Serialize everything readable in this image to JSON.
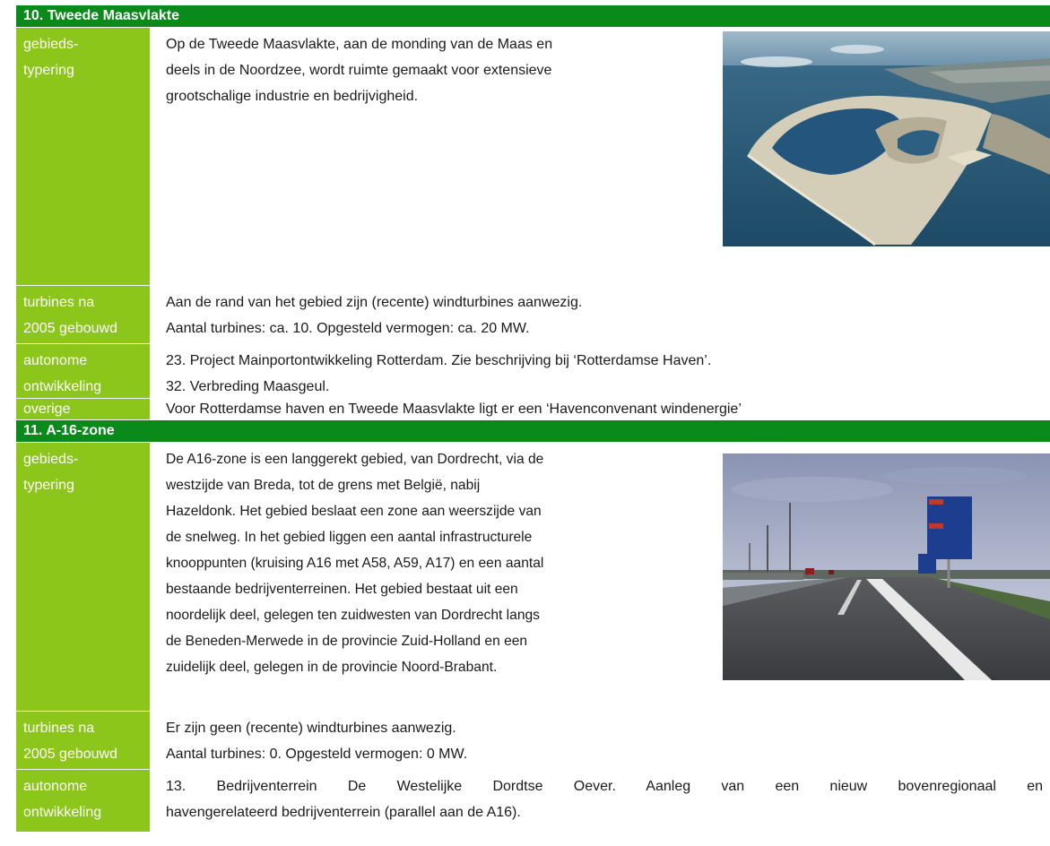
{
  "sections": [
    {
      "title": "10. Tweede Maasvlakte",
      "typering_label": [
        "gebieds-",
        "typering"
      ],
      "typering_text": [
        "Op de Tweede Maasvlakte, aan de monding van de Maas en",
        "deels in de Noordzee, wordt ruimte gemaakt voor extensieve",
        "grootschalige industrie en bedrijvigheid."
      ],
      "photo_icon": "aerial-harbor-photo",
      "turbines_label": [
        "turbines na",
        "2005 gebouwd"
      ],
      "turbines_text": [
        "Aan de rand van het gebied zijn (recente) windturbines aanwezig.",
        "Aantal turbines: ca. 10. Opgesteld vermogen: ca. 20 MW."
      ],
      "autonoom_label": [
        "autonome",
        "ontwikkeling"
      ],
      "autonoom_text": [
        "23. Project Mainportontwikkeling Rotterdam. Zie beschrijving bij ‘Rotterdamse Haven’.",
        "32. Verbreding Maasgeul."
      ],
      "overige_label": "overige",
      "overige_text": "Voor Rotterdamse haven en Tweede Maasvlakte ligt er een ‘Havenconvenant windenergie’"
    },
    {
      "title": "11. A-16-zone",
      "typering_label": [
        "gebieds-",
        "typering"
      ],
      "typering_text": [
        "De A16-zone is een langgerekt gebied, van Dordrecht, via de",
        "westzijde van Breda, tot de grens met België, nabij",
        "Hazeldonk. Het gebied beslaat een zone aan weerszijde van",
        "de snelweg. In het gebied liggen een aantal infrastructurele",
        "knooppunten (kruising A16 met A58, A59, A17) en een aantal",
        "bestaande bedrijventerreinen. Het gebied bestaat uit een",
        "noordelijk deel, gelegen ten zuidwesten van Dordrecht langs",
        "de Beneden-Merwede in de provincie Zuid-Holland en een",
        "zuidelijk deel, gelegen in de provincie Noord-Brabant."
      ],
      "photo_icon": "highway-photo",
      "turbines_label": [
        "turbines na",
        "2005 gebouwd"
      ],
      "turbines_text": [
        "Er zijn geen (recente) windturbines aanwezig.",
        "Aantal turbines: 0. Opgesteld vermogen: 0 MW."
      ],
      "autonoom_label": [
        "autonome",
        "ontwikkeling"
      ],
      "autonoom_text": [
        "13. Bedrijventerrein De Westelijke Dordtse Oever. Aanleg van een nieuw bovenregionaal en",
        "havengerelateerd bedrijventerrein (parallel aan de A16)."
      ]
    }
  ],
  "colors": {
    "header": "#0a8a1a",
    "label": "#8cc61a"
  }
}
